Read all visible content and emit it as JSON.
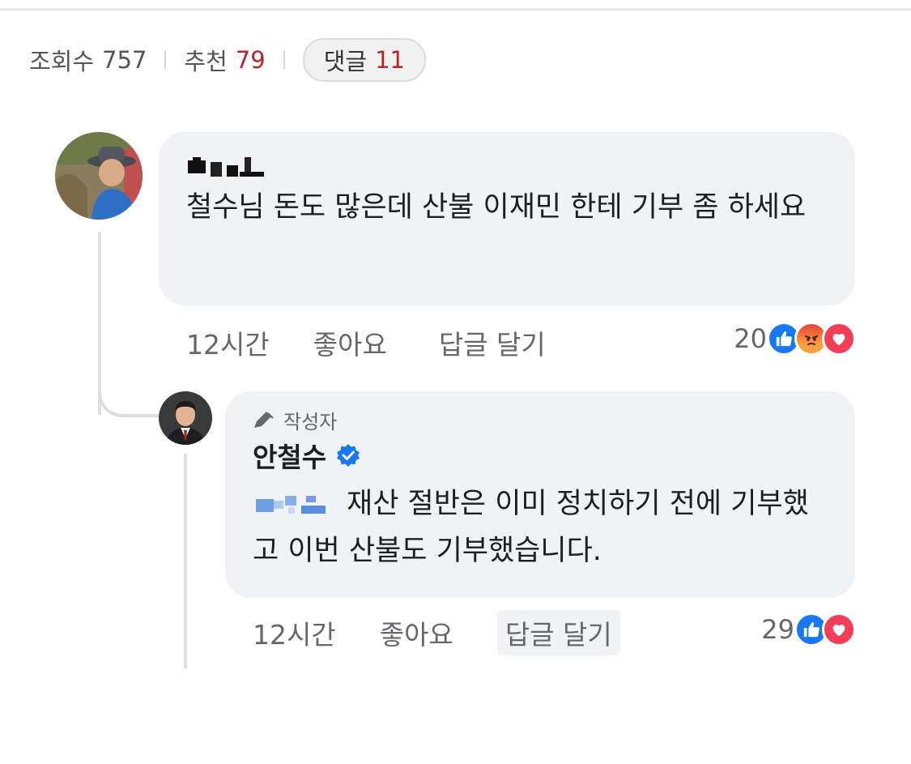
{
  "stats": {
    "views_label": "조회수",
    "views_count": "757",
    "recommend_label": "추천",
    "recommend_count": "79",
    "comments_label": "댓글",
    "comments_count": "11"
  },
  "comments": [
    {
      "text": "철수님 돈도 많은데 산불 이재민 한테 기부 좀 하세요",
      "time": "12시간",
      "like_label": "좋아요",
      "reply_label": "답글 달기",
      "reaction_count": "20",
      "reactions": [
        "like-icon",
        "angry-icon",
        "love-icon"
      ]
    },
    {
      "author_tag": "작성자",
      "author": "안철수",
      "text": "재산 절반은 이미 정치하기 전에 기부했고 이번 산불도 기부했습니다.",
      "time": "12시간",
      "like_label": "좋아요",
      "reply_label": "답글 달기",
      "reaction_count": "29",
      "reactions": [
        "like-icon",
        "love-icon"
      ]
    }
  ],
  "colors": {
    "recommend_count": "#b8262d",
    "comments_count": "#b8262d",
    "like": "#1877f2",
    "love": "#f33e58",
    "bubble": "#f0f2f5"
  }
}
